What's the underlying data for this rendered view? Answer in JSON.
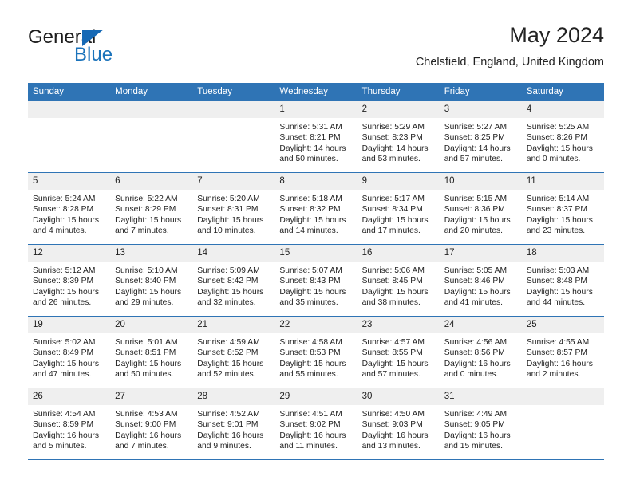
{
  "branding": {
    "logo_primary": "General",
    "logo_secondary": "Blue",
    "logo_icon": "triangle-flag-icon",
    "primary_color": "#2f74b5",
    "accent_color": "#1b73bb"
  },
  "header": {
    "title": "May 2024",
    "subtitle": "Chelsfield, England, United Kingdom"
  },
  "calendar": {
    "weekday_headers": [
      "Sunday",
      "Monday",
      "Tuesday",
      "Wednesday",
      "Thursday",
      "Friday",
      "Saturday"
    ],
    "labels": {
      "sunrise": "Sunrise:",
      "sunset": "Sunset:",
      "daylight": "Daylight:"
    },
    "weeks": [
      [
        {
          "day": "",
          "empty": true
        },
        {
          "day": "",
          "empty": true
        },
        {
          "day": "",
          "empty": true
        },
        {
          "day": "1",
          "sunrise": "Sunrise: 5:31 AM",
          "sunset": "Sunset: 8:21 PM",
          "daylight_1": "Daylight: 14 hours",
          "daylight_2": "and 50 minutes."
        },
        {
          "day": "2",
          "sunrise": "Sunrise: 5:29 AM",
          "sunset": "Sunset: 8:23 PM",
          "daylight_1": "Daylight: 14 hours",
          "daylight_2": "and 53 minutes."
        },
        {
          "day": "3",
          "sunrise": "Sunrise: 5:27 AM",
          "sunset": "Sunset: 8:25 PM",
          "daylight_1": "Daylight: 14 hours",
          "daylight_2": "and 57 minutes."
        },
        {
          "day": "4",
          "sunrise": "Sunrise: 5:25 AM",
          "sunset": "Sunset: 8:26 PM",
          "daylight_1": "Daylight: 15 hours",
          "daylight_2": "and 0 minutes."
        }
      ],
      [
        {
          "day": "5",
          "sunrise": "Sunrise: 5:24 AM",
          "sunset": "Sunset: 8:28 PM",
          "daylight_1": "Daylight: 15 hours",
          "daylight_2": "and 4 minutes."
        },
        {
          "day": "6",
          "sunrise": "Sunrise: 5:22 AM",
          "sunset": "Sunset: 8:29 PM",
          "daylight_1": "Daylight: 15 hours",
          "daylight_2": "and 7 minutes."
        },
        {
          "day": "7",
          "sunrise": "Sunrise: 5:20 AM",
          "sunset": "Sunset: 8:31 PM",
          "daylight_1": "Daylight: 15 hours",
          "daylight_2": "and 10 minutes."
        },
        {
          "day": "8",
          "sunrise": "Sunrise: 5:18 AM",
          "sunset": "Sunset: 8:32 PM",
          "daylight_1": "Daylight: 15 hours",
          "daylight_2": "and 14 minutes."
        },
        {
          "day": "9",
          "sunrise": "Sunrise: 5:17 AM",
          "sunset": "Sunset: 8:34 PM",
          "daylight_1": "Daylight: 15 hours",
          "daylight_2": "and 17 minutes."
        },
        {
          "day": "10",
          "sunrise": "Sunrise: 5:15 AM",
          "sunset": "Sunset: 8:36 PM",
          "daylight_1": "Daylight: 15 hours",
          "daylight_2": "and 20 minutes."
        },
        {
          "day": "11",
          "sunrise": "Sunrise: 5:14 AM",
          "sunset": "Sunset: 8:37 PM",
          "daylight_1": "Daylight: 15 hours",
          "daylight_2": "and 23 minutes."
        }
      ],
      [
        {
          "day": "12",
          "sunrise": "Sunrise: 5:12 AM",
          "sunset": "Sunset: 8:39 PM",
          "daylight_1": "Daylight: 15 hours",
          "daylight_2": "and 26 minutes."
        },
        {
          "day": "13",
          "sunrise": "Sunrise: 5:10 AM",
          "sunset": "Sunset: 8:40 PM",
          "daylight_1": "Daylight: 15 hours",
          "daylight_2": "and 29 minutes."
        },
        {
          "day": "14",
          "sunrise": "Sunrise: 5:09 AM",
          "sunset": "Sunset: 8:42 PM",
          "daylight_1": "Daylight: 15 hours",
          "daylight_2": "and 32 minutes."
        },
        {
          "day": "15",
          "sunrise": "Sunrise: 5:07 AM",
          "sunset": "Sunset: 8:43 PM",
          "daylight_1": "Daylight: 15 hours",
          "daylight_2": "and 35 minutes."
        },
        {
          "day": "16",
          "sunrise": "Sunrise: 5:06 AM",
          "sunset": "Sunset: 8:45 PM",
          "daylight_1": "Daylight: 15 hours",
          "daylight_2": "and 38 minutes."
        },
        {
          "day": "17",
          "sunrise": "Sunrise: 5:05 AM",
          "sunset": "Sunset: 8:46 PM",
          "daylight_1": "Daylight: 15 hours",
          "daylight_2": "and 41 minutes."
        },
        {
          "day": "18",
          "sunrise": "Sunrise: 5:03 AM",
          "sunset": "Sunset: 8:48 PM",
          "daylight_1": "Daylight: 15 hours",
          "daylight_2": "and 44 minutes."
        }
      ],
      [
        {
          "day": "19",
          "sunrise": "Sunrise: 5:02 AM",
          "sunset": "Sunset: 8:49 PM",
          "daylight_1": "Daylight: 15 hours",
          "daylight_2": "and 47 minutes."
        },
        {
          "day": "20",
          "sunrise": "Sunrise: 5:01 AM",
          "sunset": "Sunset: 8:51 PM",
          "daylight_1": "Daylight: 15 hours",
          "daylight_2": "and 50 minutes."
        },
        {
          "day": "21",
          "sunrise": "Sunrise: 4:59 AM",
          "sunset": "Sunset: 8:52 PM",
          "daylight_1": "Daylight: 15 hours",
          "daylight_2": "and 52 minutes."
        },
        {
          "day": "22",
          "sunrise": "Sunrise: 4:58 AM",
          "sunset": "Sunset: 8:53 PM",
          "daylight_1": "Daylight: 15 hours",
          "daylight_2": "and 55 minutes."
        },
        {
          "day": "23",
          "sunrise": "Sunrise: 4:57 AM",
          "sunset": "Sunset: 8:55 PM",
          "daylight_1": "Daylight: 15 hours",
          "daylight_2": "and 57 minutes."
        },
        {
          "day": "24",
          "sunrise": "Sunrise: 4:56 AM",
          "sunset": "Sunset: 8:56 PM",
          "daylight_1": "Daylight: 16 hours",
          "daylight_2": "and 0 minutes."
        },
        {
          "day": "25",
          "sunrise": "Sunrise: 4:55 AM",
          "sunset": "Sunset: 8:57 PM",
          "daylight_1": "Daylight: 16 hours",
          "daylight_2": "and 2 minutes."
        }
      ],
      [
        {
          "day": "26",
          "sunrise": "Sunrise: 4:54 AM",
          "sunset": "Sunset: 8:59 PM",
          "daylight_1": "Daylight: 16 hours",
          "daylight_2": "and 5 minutes."
        },
        {
          "day": "27",
          "sunrise": "Sunrise: 4:53 AM",
          "sunset": "Sunset: 9:00 PM",
          "daylight_1": "Daylight: 16 hours",
          "daylight_2": "and 7 minutes."
        },
        {
          "day": "28",
          "sunrise": "Sunrise: 4:52 AM",
          "sunset": "Sunset: 9:01 PM",
          "daylight_1": "Daylight: 16 hours",
          "daylight_2": "and 9 minutes."
        },
        {
          "day": "29",
          "sunrise": "Sunrise: 4:51 AM",
          "sunset": "Sunset: 9:02 PM",
          "daylight_1": "Daylight: 16 hours",
          "daylight_2": "and 11 minutes."
        },
        {
          "day": "30",
          "sunrise": "Sunrise: 4:50 AM",
          "sunset": "Sunset: 9:03 PM",
          "daylight_1": "Daylight: 16 hours",
          "daylight_2": "and 13 minutes."
        },
        {
          "day": "31",
          "sunrise": "Sunrise: 4:49 AM",
          "sunset": "Sunset: 9:05 PM",
          "daylight_1": "Daylight: 16 hours",
          "daylight_2": "and 15 minutes."
        },
        {
          "day": "",
          "empty": true
        }
      ]
    ]
  }
}
